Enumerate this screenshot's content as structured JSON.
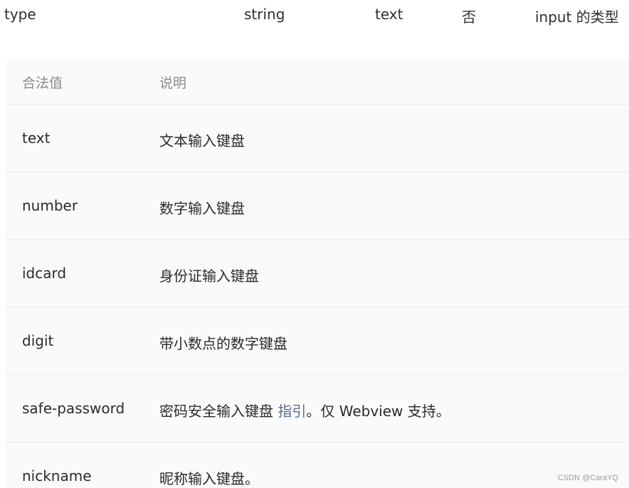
{
  "property": {
    "name": "type",
    "type": "string",
    "default": "text",
    "required": "否",
    "description": "input 的类型"
  },
  "table": {
    "headers": [
      "合法值",
      "说明"
    ],
    "rows": [
      {
        "value": "text",
        "desc": "文本输入键盘"
      },
      {
        "value": "number",
        "desc": "数字输入键盘"
      },
      {
        "value": "idcard",
        "desc": "身份证输入键盘"
      },
      {
        "value": "digit",
        "desc": "带小数点的数字键盘"
      },
      {
        "value": "safe-password",
        "desc_before": "密码安全输入键盘 ",
        "link": "指引",
        "desc_after": "。仅 Webview 支持。"
      },
      {
        "value": "nickname",
        "desc": "昵称输入键盘。"
      }
    ]
  },
  "watermark": "CSDN @CaraYQ"
}
